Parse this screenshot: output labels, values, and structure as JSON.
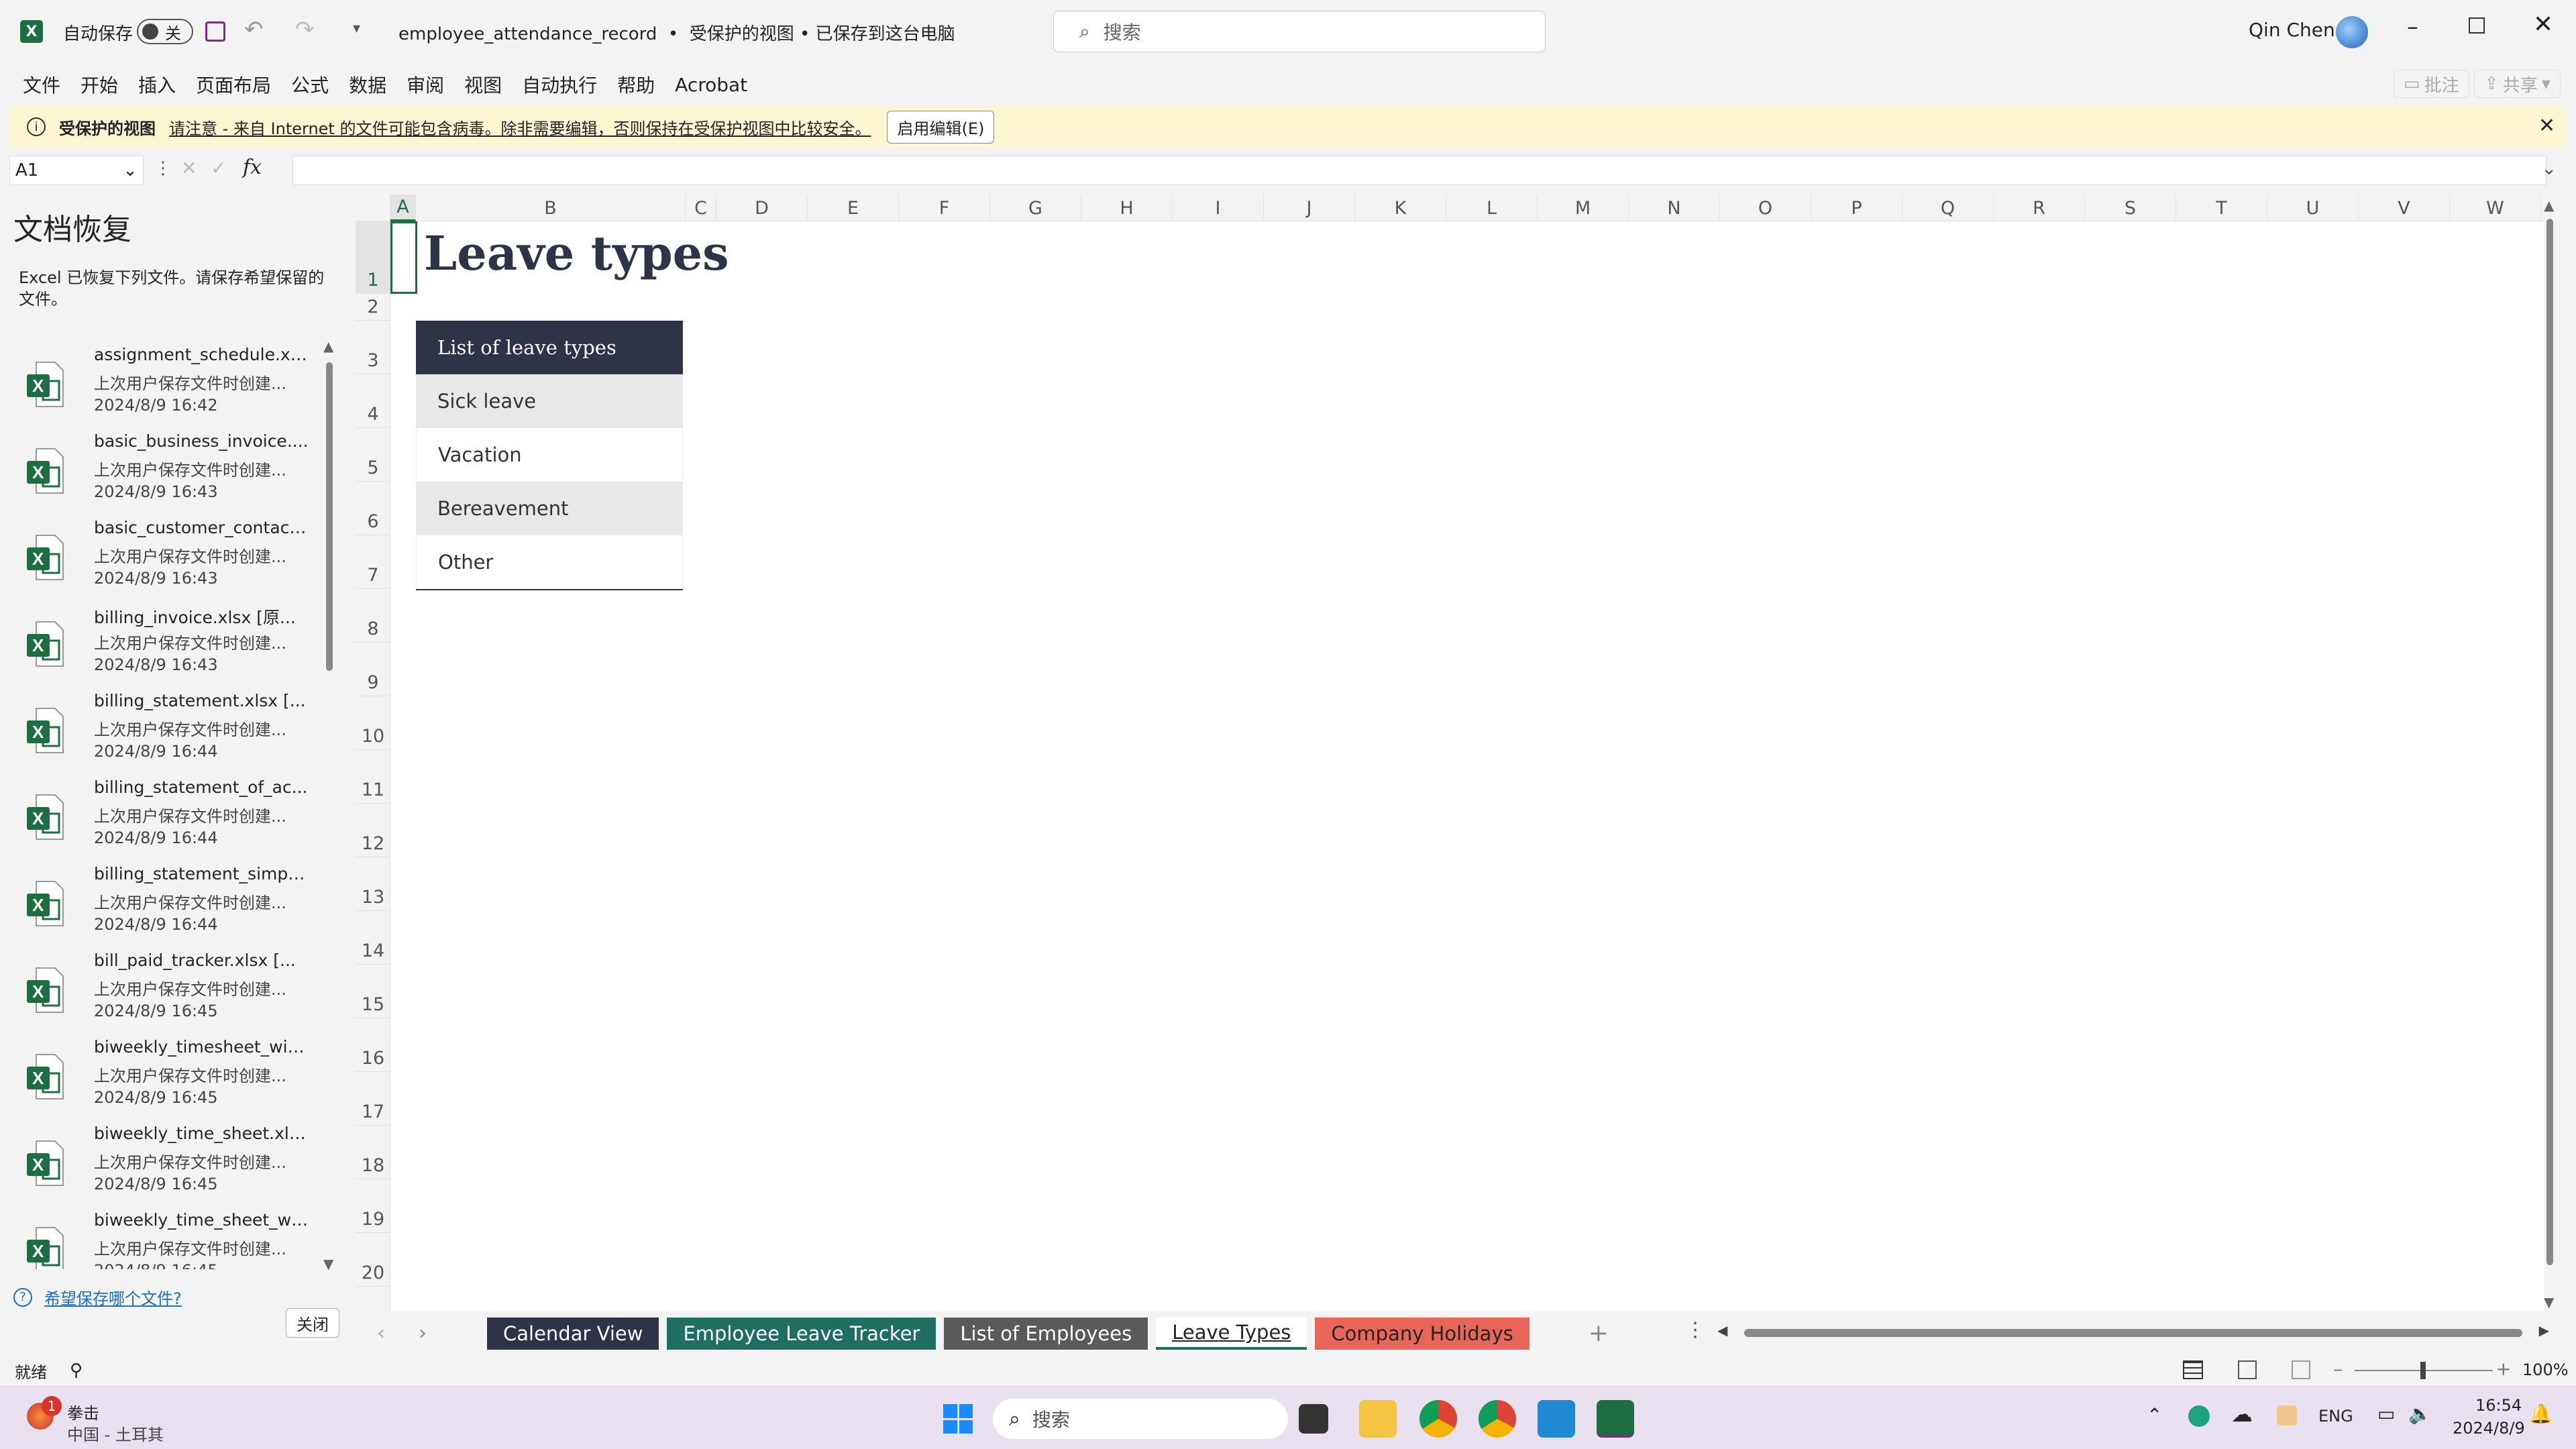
{
  "titlebar": {
    "autosave_label": "自动保存",
    "autosave_state": "关",
    "doc_title": "employee_attendance_record  •  受保护的视图 • 已保存到这台电脑",
    "search_placeholder": "搜索",
    "user_name": "Qin Chen"
  },
  "menu": [
    "文件",
    "开始",
    "插入",
    "页面布局",
    "公式",
    "数据",
    "审阅",
    "视图",
    "自动执行",
    "帮助",
    "Acrobat"
  ],
  "menu_right": {
    "comments": "批注",
    "share": "共享"
  },
  "protected": {
    "title": "受保护的视图",
    "message": "请注意 - 来自 Internet 的文件可能包含病毒。除非需要编辑，否则保持在受保护视图中比较安全。",
    "button": "启用编辑(E)"
  },
  "formula_bar": {
    "cell_ref": "A1",
    "fx": "fx",
    "value": ""
  },
  "recovery": {
    "title": "文档恢复",
    "subtitle": "Excel 已恢复下列文件。请保存希望保留的文件。",
    "items": [
      {
        "name": "assignment_schedule.xl...",
        "desc": "上次用户保存文件时创建...",
        "time": "2024/8/9 16:42"
      },
      {
        "name": "basic_business_invoice....",
        "desc": "上次用户保存文件时创建...",
        "time": "2024/8/9 16:43"
      },
      {
        "name": "basic_customer_contact...",
        "desc": "上次用户保存文件时创建...",
        "time": "2024/8/9 16:43"
      },
      {
        "name": "billing_invoice.xlsx  [原...",
        "desc": "上次用户保存文件时创建...",
        "time": "2024/8/9 16:43"
      },
      {
        "name": "billing_statement.xlsx  [...",
        "desc": "上次用户保存文件时创建...",
        "time": "2024/8/9 16:44"
      },
      {
        "name": "billing_statement_of_ac...",
        "desc": "上次用户保存文件时创建...",
        "time": "2024/8/9 16:44"
      },
      {
        "name": "billing_statement_simpl...",
        "desc": "上次用户保存文件时创建...",
        "time": "2024/8/9 16:44"
      },
      {
        "name": "bill_paid_tracker.xlsx  [...",
        "desc": "上次用户保存文件时创建...",
        "time": "2024/8/9 16:45"
      },
      {
        "name": "biweekly_timesheet_wit...",
        "desc": "上次用户保存文件时创建...",
        "time": "2024/8/9 16:45"
      },
      {
        "name": "biweekly_time_sheet.xls...",
        "desc": "上次用户保存文件时创建...",
        "time": "2024/8/9 16:45"
      },
      {
        "name": "biweekly_time_sheet_wi...",
        "desc": "上次用户保存文件时创建...",
        "time": "2024/8/9 16:45"
      }
    ],
    "help_link": "希望保存哪个文件?",
    "close_button": "关闭"
  },
  "columns": [
    "A",
    "B",
    "C",
    "D",
    "E",
    "F",
    "G",
    "H",
    "I",
    "J",
    "K",
    "L",
    "M",
    "N",
    "O",
    "P",
    "Q",
    "R",
    "S",
    "T",
    "U",
    "V",
    "W"
  ],
  "rows": [
    "1",
    "2",
    "3",
    "4",
    "5",
    "6",
    "7",
    "8",
    "9",
    "10",
    "11",
    "12",
    "13",
    "14",
    "15",
    "16",
    "17",
    "18",
    "19",
    "20"
  ],
  "sheet": {
    "heading": "Leave types",
    "table_header": "List of leave types",
    "leave_types": [
      "Sick leave",
      "Vacation",
      "Bereavement",
      "Other"
    ]
  },
  "tabs": [
    {
      "label": "Calendar View",
      "color": "#2e3347"
    },
    {
      "label": "Employee Leave Tracker",
      "color": "#1f6e62"
    },
    {
      "label": "List of Employees",
      "color": "#5a5a5a"
    },
    {
      "label": "Leave Types",
      "color": "#ffffff"
    },
    {
      "label": "Company Holidays",
      "color": "#e8655a"
    }
  ],
  "status": {
    "ready": "就绪",
    "zoom": "100%"
  },
  "taskbar": {
    "weather_title": "拳击",
    "weather_sub": "中国 - 土耳其",
    "search": "搜索",
    "lang": "ENG",
    "time": "16:54",
    "date": "2024/8/9",
    "badge": "1"
  }
}
